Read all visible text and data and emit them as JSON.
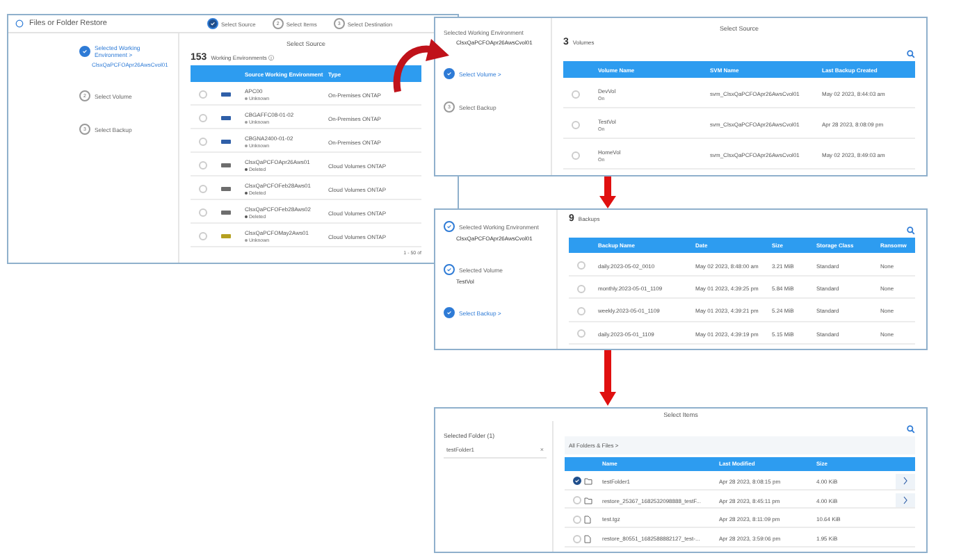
{
  "source_window": {
    "title": "Files or Folder Restore",
    "wizard_steps": [
      {
        "label": "Select Source",
        "kind": "done"
      },
      {
        "number": "2",
        "label": "Select Items",
        "kind": "pending"
      },
      {
        "number": "3",
        "label": "Select Destination",
        "kind": "pending"
      }
    ],
    "stepper": [
      {
        "kind": "active",
        "label": "Selected Working Environment >",
        "value": "ClsxQaPCFOApr26AwsCvol01"
      },
      {
        "kind": "pending",
        "number": "2",
        "label": "Select Volume"
      },
      {
        "kind": "pending",
        "number": "3",
        "label": "Select Backup"
      }
    ],
    "heading": "Select Source",
    "count": "153",
    "count_label": "Working Environments ⓘ",
    "columns": [
      "Source Working Environment",
      "Type"
    ],
    "rows": [
      {
        "selected": false,
        "kind": "onprem",
        "name": "APC00",
        "status": "Unknown",
        "color": "#9e9e9e",
        "type": "On-Premises ONTAP"
      },
      {
        "selected": false,
        "kind": "onprem",
        "name": "CBGAFFC08-01-02",
        "status": "Unknown",
        "color": "#9e9e9e",
        "type": "On-Premises ONTAP"
      },
      {
        "selected": false,
        "kind": "onprem",
        "name": "CBGNA2400-01-02",
        "status": "Unknown",
        "color": "#9e9e9e",
        "type": "On-Premises ONTAP"
      },
      {
        "selected": false,
        "kind": "cloud",
        "name": "ClsxQaPCFOApr26Aws01",
        "status": "Deleted",
        "color": "#555555",
        "type": "Cloud Volumes ONTAP"
      },
      {
        "selected": false,
        "kind": "cloud",
        "name": "ClsxQaPCFOFeb28Aws01",
        "status": "Deleted",
        "color": "#555555",
        "type": "Cloud Volumes ONTAP"
      },
      {
        "selected": false,
        "kind": "cloud",
        "name": "ClsxQaPCFOFeb28Aws02",
        "status": "Deleted",
        "color": "#555555",
        "type": "Cloud Volumes ONTAP"
      },
      {
        "selected": false,
        "kind": "other",
        "name": "ClsxQaPCFOMay2Aws01",
        "status": "Unknown",
        "color": "#9e9e9e",
        "type": "Cloud Volumes ONTAP"
      }
    ],
    "pagination": "1 - 50 of"
  },
  "volume_window": {
    "heading": "Select Source",
    "stepper": [
      {
        "kind": "plain",
        "label": "Selected Working Environment",
        "value": "ClsxQaPCFOApr26AwsCvol01"
      },
      {
        "kind": "active",
        "label": "Select Volume >"
      },
      {
        "kind": "pending",
        "number": "3",
        "label": "Select Backup"
      }
    ],
    "count": "3",
    "count_label": "Volumes",
    "columns": [
      "Volume Name",
      "SVM Name",
      "Last Backup Created"
    ],
    "rows": [
      {
        "selected": false,
        "name": "DevVol",
        "status": "On",
        "svm": "svm_ClsxQaPCFOApr26AwsCvol01",
        "date": "May 02 2023, 8:44:03 am"
      },
      {
        "selected": false,
        "name": "TestVol",
        "status": "On",
        "svm": "svm_ClsxQaPCFOApr26AwsCvol01",
        "date": "Apr 28 2023, 8:08:09 pm"
      },
      {
        "selected": false,
        "name": "HomeVol",
        "status": "On",
        "svm": "svm_ClsxQaPCFOApr26AwsCvol01",
        "date": "May 02 2023, 8:49:03 am"
      }
    ]
  },
  "backup_window": {
    "stepper": [
      {
        "kind": "done",
        "label": "Selected Working Environment",
        "value": "ClsxQaPCFOApr26AwsCvol01"
      },
      {
        "kind": "done",
        "label": "Selected Volume",
        "value": "TestVol"
      },
      {
        "kind": "active",
        "label": "Select Backup >"
      }
    ],
    "count": "9",
    "count_label": "Backups",
    "columns": [
      "Backup Name",
      "Date",
      "Size",
      "Storage Class",
      "Ransomw"
    ],
    "rows": [
      {
        "selected": false,
        "cells": [
          "daily.2023-05-02_0010",
          "May 02 2023, 8:48:00 am",
          "3.21 MiB",
          "Standard",
          "None"
        ]
      },
      {
        "selected": false,
        "cells": [
          "monthly.2023-05-01_1109",
          "May 01 2023, 4:39:25 pm",
          "5.84 MiB",
          "Standard",
          "None"
        ]
      },
      {
        "selected": false,
        "cells": [
          "weekly.2023-05-01_1109",
          "May 01 2023, 4:39:21 pm",
          "5.24 MiB",
          "Standard",
          "None"
        ]
      },
      {
        "selected": false,
        "cells": [
          "daily.2023-05-01_1109",
          "May 01 2023, 4:39:19 pm",
          "5.15 MiB",
          "Standard",
          "None"
        ]
      }
    ]
  },
  "items_window": {
    "heading": "Select Items",
    "selected_label": "Selected Folder (1)",
    "selected_items": [
      {
        "name": "testFolder1",
        "remove": "×"
      }
    ],
    "breadcrumb": "All Folders & Files >",
    "columns": [
      "Name",
      "Last Modified",
      "Size"
    ],
    "rows": [
      {
        "selected": true,
        "kind": "folder",
        "name": "testFolder1",
        "modified": "Apr 28 2023, 8:08:15 pm",
        "size": "4.00 KiB"
      },
      {
        "selected": false,
        "kind": "folder",
        "name": "restore_25367_1682532098888_testF...",
        "modified": "Apr 28 2023, 8:45:11 pm",
        "size": "4.00 KiB"
      },
      {
        "selected": false,
        "kind": "file",
        "name": "test.tgz",
        "modified": "Apr 28 2023, 8:11:09 pm",
        "size": "10.64 KiB"
      },
      {
        "selected": false,
        "kind": "file",
        "name": "restore_80551_1682588882127_test-...",
        "modified": "Apr 28 2023, 3:59:06 pm",
        "size": "1.95 KiB"
      }
    ]
  }
}
